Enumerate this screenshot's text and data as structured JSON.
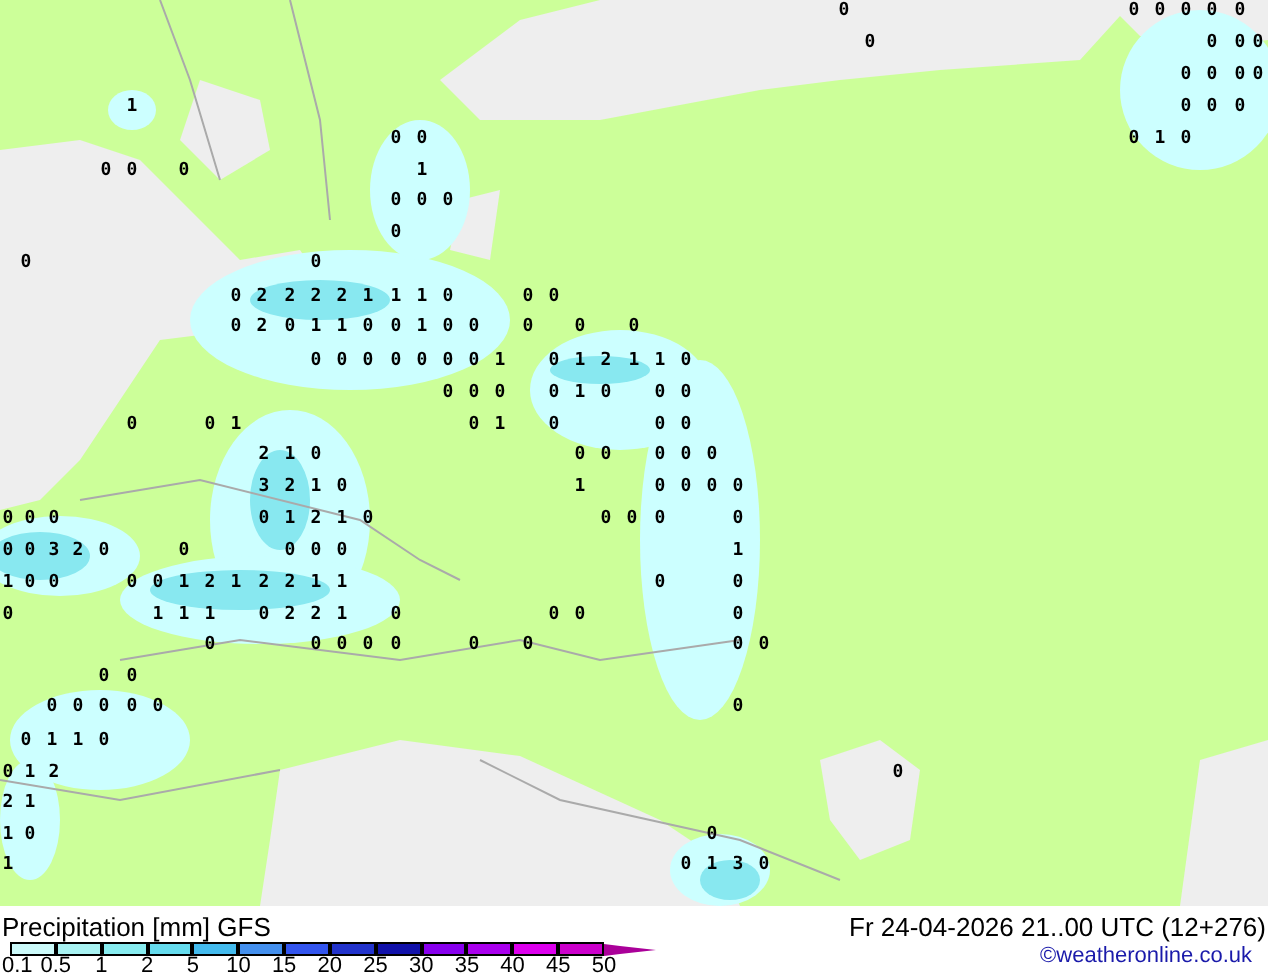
{
  "map": {
    "value_rows": [
      [
        "0",
        "0",
        "0",
        "0",
        "0",
        "0"
      ],
      [
        "0",
        "0",
        "0",
        "0"
      ],
      [
        "0",
        "0",
        "0",
        "0"
      ],
      [
        "1",
        "0",
        "0",
        "0"
      ],
      [
        "0",
        "0",
        "0",
        "1",
        "0"
      ],
      [
        "0",
        "0",
        "0",
        "1"
      ],
      [
        "0",
        "0",
        "0"
      ],
      [
        "0"
      ],
      [
        "0",
        "0"
      ],
      [
        "0",
        "2",
        "2",
        "2",
        "2",
        "1",
        "1",
        "1",
        "0",
        "0",
        "0"
      ],
      [
        "0",
        "2",
        "0",
        "1",
        "1",
        "0",
        "0",
        "1",
        "0",
        "0",
        "0",
        "0",
        "0"
      ],
      [
        "0",
        "0",
        "0",
        "0",
        "0",
        "0",
        "0",
        "1",
        "0",
        "1",
        "2",
        "1",
        "1",
        "0"
      ],
      [
        "0",
        "0",
        "0",
        "0",
        "1",
        "0",
        "0",
        "0"
      ],
      [
        "0",
        "0",
        "1",
        "0",
        "1",
        "0",
        "0",
        "0"
      ],
      [
        "2",
        "1",
        "0",
        "0",
        "0",
        "0",
        "0",
        "0"
      ],
      [
        "3",
        "2",
        "1",
        "0",
        "1",
        "0",
        "0",
        "0",
        "0"
      ],
      [
        "0",
        "0",
        "0",
        "0",
        "1",
        "2",
        "1",
        "0",
        "0",
        "0",
        "0",
        "0"
      ],
      [
        "0",
        "0",
        "3",
        "2",
        "0",
        "0",
        "0",
        "0",
        "0",
        "1"
      ],
      [
        "1",
        "0",
        "0",
        "0",
        "0",
        "1",
        "2",
        "1",
        "2",
        "2",
        "1",
        "1",
        "0",
        "0"
      ],
      [
        "0",
        "1",
        "1",
        "1",
        "0",
        "2",
        "2",
        "1",
        "0",
        "0",
        "0",
        "0"
      ],
      [
        "0",
        "0",
        "0",
        "0",
        "0",
        "0",
        "0",
        "0",
        "0"
      ],
      [
        "0",
        "0"
      ],
      [
        "0",
        "0",
        "0",
        "0",
        "0",
        "0"
      ],
      [
        "0",
        "1",
        "1",
        "0"
      ],
      [
        "0",
        "1",
        "2",
        "0"
      ],
      [
        "2",
        "1"
      ],
      [
        "1",
        "0",
        "0"
      ],
      [
        "1",
        "0",
        "1",
        "3",
        "0"
      ]
    ]
  },
  "legend": {
    "title": "Precipitation [mm] GFS",
    "segments": [
      {
        "color": "#ccfafa"
      },
      {
        "color": "#a8f2f2"
      },
      {
        "color": "#88ecf0"
      },
      {
        "color": "#66dcee"
      },
      {
        "color": "#44bbee"
      },
      {
        "color": "#4490ee"
      },
      {
        "color": "#3355ee"
      },
      {
        "color": "#2233cc"
      },
      {
        "color": "#1111aa"
      },
      {
        "color": "#8800ee"
      },
      {
        "color": "#aa00ee"
      },
      {
        "color": "#dd00ee"
      },
      {
        "color": "#cc00cc"
      }
    ],
    "ticks": [
      "0.1",
      "0.5",
      "1",
      "2",
      "5",
      "10",
      "15",
      "20",
      "25",
      "30",
      "35",
      "40",
      "45",
      "50"
    ]
  },
  "valid_time": "Fr 24-04-2026 21..00 UTC (12+276)",
  "credit": "©weatheronline.co.uk"
}
